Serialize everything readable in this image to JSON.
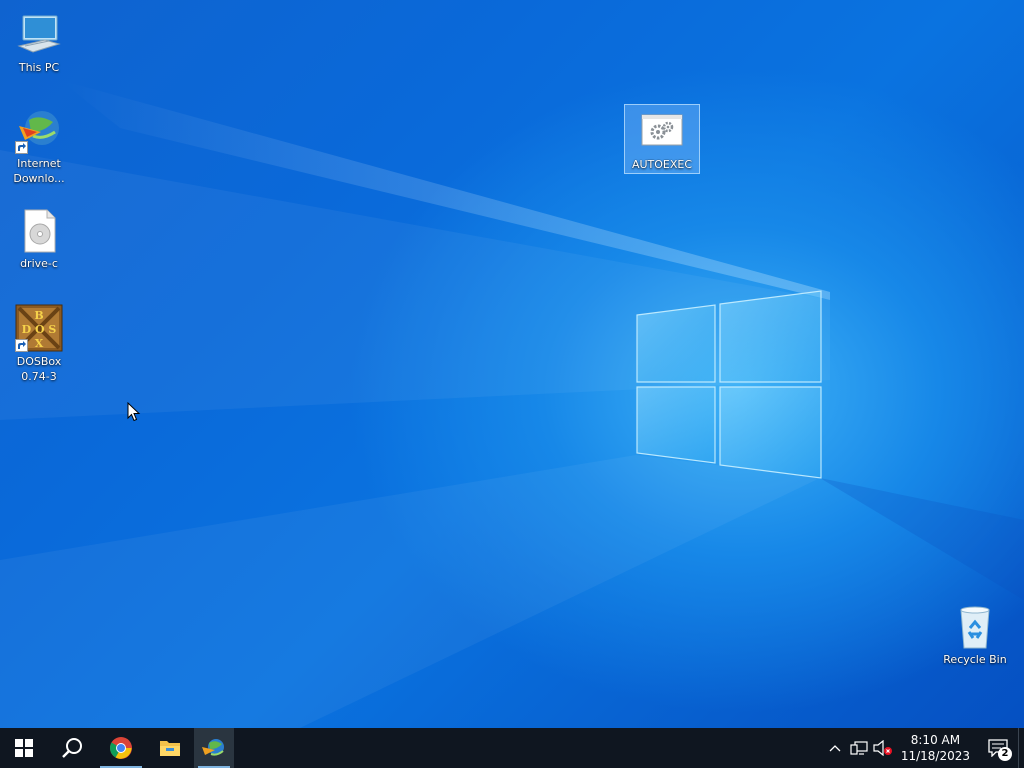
{
  "desktop": {
    "icons": [
      {
        "label": "This PC"
      },
      {
        "label": "Internet Downlo..."
      },
      {
        "label": "drive-c"
      },
      {
        "label": "DOSBox 0.74-3"
      },
      {
        "label": "AUTOEXEC"
      },
      {
        "label": "Recycle Bin"
      }
    ]
  },
  "taskbar": {
    "pinned": [
      "start-icon",
      "search-icon",
      "chrome-icon",
      "file-explorer-icon",
      "internet-download-manager-icon"
    ],
    "tray": {
      "time": "8:10 AM",
      "date": "11/18/2023",
      "notification_count": "2"
    }
  },
  "colors": {
    "taskbar": "#0f1620",
    "desktop_accent": "#1788e8"
  }
}
